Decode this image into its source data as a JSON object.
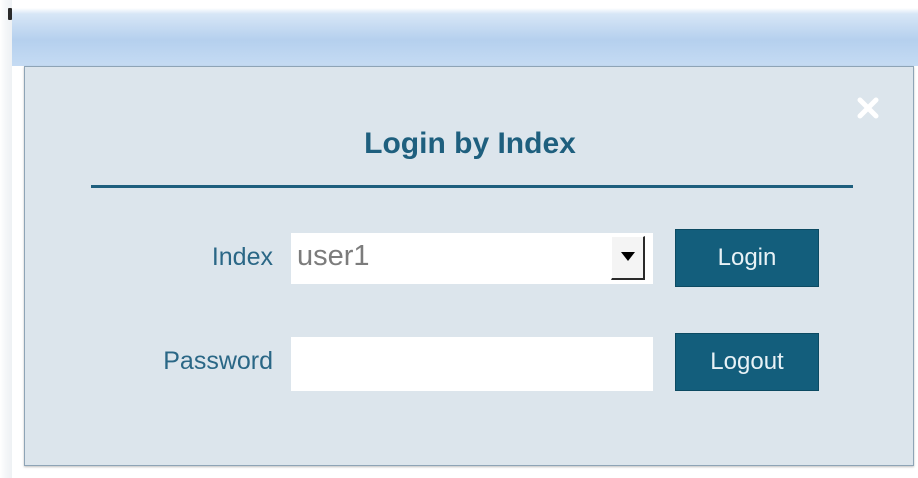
{
  "dialog": {
    "title": "Login by Index",
    "close_icon": "close-icon"
  },
  "form": {
    "index_label": "Index",
    "index_selected": "user1",
    "password_label": "Password",
    "password_value": "",
    "login_button": "Login",
    "logout_button": "Logout"
  },
  "colors": {
    "accent": "#135e7c",
    "title_text": "#1e5f7e",
    "dialog_bg": "#dce5ec"
  }
}
